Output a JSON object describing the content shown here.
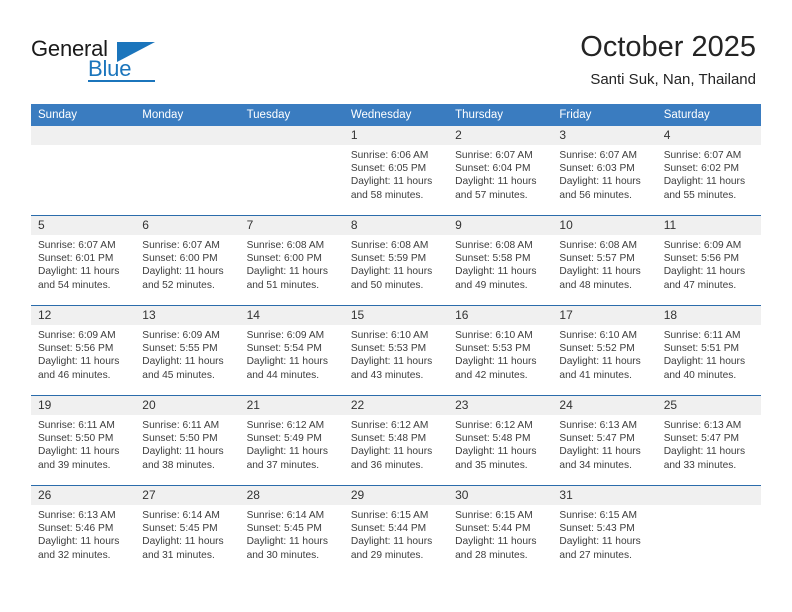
{
  "brand": {
    "name_part1": "General",
    "name_part2": "Blue",
    "accent_color": "#1b75bc"
  },
  "header": {
    "month_title": "October 2025",
    "location": "Santi Suk, Nan, Thailand"
  },
  "calendar": {
    "header_bg": "#3a7cc0",
    "row_divider_color": "#2b6cab",
    "daynum_band_color": "#f0f0f0",
    "weekday_headers": [
      "Sunday",
      "Monday",
      "Tuesday",
      "Wednesday",
      "Thursday",
      "Friday",
      "Saturday"
    ],
    "weeks": [
      [
        {
          "day": "",
          "empty": true,
          "sunrise": "",
          "sunset": "",
          "daylight1": "",
          "daylight2": ""
        },
        {
          "day": "",
          "empty": true,
          "sunrise": "",
          "sunset": "",
          "daylight1": "",
          "daylight2": ""
        },
        {
          "day": "",
          "empty": true,
          "sunrise": "",
          "sunset": "",
          "daylight1": "",
          "daylight2": ""
        },
        {
          "day": "1",
          "empty": false,
          "sunrise": "Sunrise: 6:06 AM",
          "sunset": "Sunset: 6:05 PM",
          "daylight1": "Daylight: 11 hours",
          "daylight2": "and 58 minutes."
        },
        {
          "day": "2",
          "empty": false,
          "sunrise": "Sunrise: 6:07 AM",
          "sunset": "Sunset: 6:04 PM",
          "daylight1": "Daylight: 11 hours",
          "daylight2": "and 57 minutes."
        },
        {
          "day": "3",
          "empty": false,
          "sunrise": "Sunrise: 6:07 AM",
          "sunset": "Sunset: 6:03 PM",
          "daylight1": "Daylight: 11 hours",
          "daylight2": "and 56 minutes."
        },
        {
          "day": "4",
          "empty": false,
          "sunrise": "Sunrise: 6:07 AM",
          "sunset": "Sunset: 6:02 PM",
          "daylight1": "Daylight: 11 hours",
          "daylight2": "and 55 minutes."
        }
      ],
      [
        {
          "day": "5",
          "empty": false,
          "sunrise": "Sunrise: 6:07 AM",
          "sunset": "Sunset: 6:01 PM",
          "daylight1": "Daylight: 11 hours",
          "daylight2": "and 54 minutes."
        },
        {
          "day": "6",
          "empty": false,
          "sunrise": "Sunrise: 6:07 AM",
          "sunset": "Sunset: 6:00 PM",
          "daylight1": "Daylight: 11 hours",
          "daylight2": "and 52 minutes."
        },
        {
          "day": "7",
          "empty": false,
          "sunrise": "Sunrise: 6:08 AM",
          "sunset": "Sunset: 6:00 PM",
          "daylight1": "Daylight: 11 hours",
          "daylight2": "and 51 minutes."
        },
        {
          "day": "8",
          "empty": false,
          "sunrise": "Sunrise: 6:08 AM",
          "sunset": "Sunset: 5:59 PM",
          "daylight1": "Daylight: 11 hours",
          "daylight2": "and 50 minutes."
        },
        {
          "day": "9",
          "empty": false,
          "sunrise": "Sunrise: 6:08 AM",
          "sunset": "Sunset: 5:58 PM",
          "daylight1": "Daylight: 11 hours",
          "daylight2": "and 49 minutes."
        },
        {
          "day": "10",
          "empty": false,
          "sunrise": "Sunrise: 6:08 AM",
          "sunset": "Sunset: 5:57 PM",
          "daylight1": "Daylight: 11 hours",
          "daylight2": "and 48 minutes."
        },
        {
          "day": "11",
          "empty": false,
          "sunrise": "Sunrise: 6:09 AM",
          "sunset": "Sunset: 5:56 PM",
          "daylight1": "Daylight: 11 hours",
          "daylight2": "and 47 minutes."
        }
      ],
      [
        {
          "day": "12",
          "empty": false,
          "sunrise": "Sunrise: 6:09 AM",
          "sunset": "Sunset: 5:56 PM",
          "daylight1": "Daylight: 11 hours",
          "daylight2": "and 46 minutes."
        },
        {
          "day": "13",
          "empty": false,
          "sunrise": "Sunrise: 6:09 AM",
          "sunset": "Sunset: 5:55 PM",
          "daylight1": "Daylight: 11 hours",
          "daylight2": "and 45 minutes."
        },
        {
          "day": "14",
          "empty": false,
          "sunrise": "Sunrise: 6:09 AM",
          "sunset": "Sunset: 5:54 PM",
          "daylight1": "Daylight: 11 hours",
          "daylight2": "and 44 minutes."
        },
        {
          "day": "15",
          "empty": false,
          "sunrise": "Sunrise: 6:10 AM",
          "sunset": "Sunset: 5:53 PM",
          "daylight1": "Daylight: 11 hours",
          "daylight2": "and 43 minutes."
        },
        {
          "day": "16",
          "empty": false,
          "sunrise": "Sunrise: 6:10 AM",
          "sunset": "Sunset: 5:53 PM",
          "daylight1": "Daylight: 11 hours",
          "daylight2": "and 42 minutes."
        },
        {
          "day": "17",
          "empty": false,
          "sunrise": "Sunrise: 6:10 AM",
          "sunset": "Sunset: 5:52 PM",
          "daylight1": "Daylight: 11 hours",
          "daylight2": "and 41 minutes."
        },
        {
          "day": "18",
          "empty": false,
          "sunrise": "Sunrise: 6:11 AM",
          "sunset": "Sunset: 5:51 PM",
          "daylight1": "Daylight: 11 hours",
          "daylight2": "and 40 minutes."
        }
      ],
      [
        {
          "day": "19",
          "empty": false,
          "sunrise": "Sunrise: 6:11 AM",
          "sunset": "Sunset: 5:50 PM",
          "daylight1": "Daylight: 11 hours",
          "daylight2": "and 39 minutes."
        },
        {
          "day": "20",
          "empty": false,
          "sunrise": "Sunrise: 6:11 AM",
          "sunset": "Sunset: 5:50 PM",
          "daylight1": "Daylight: 11 hours",
          "daylight2": "and 38 minutes."
        },
        {
          "day": "21",
          "empty": false,
          "sunrise": "Sunrise: 6:12 AM",
          "sunset": "Sunset: 5:49 PM",
          "daylight1": "Daylight: 11 hours",
          "daylight2": "and 37 minutes."
        },
        {
          "day": "22",
          "empty": false,
          "sunrise": "Sunrise: 6:12 AM",
          "sunset": "Sunset: 5:48 PM",
          "daylight1": "Daylight: 11 hours",
          "daylight2": "and 36 minutes."
        },
        {
          "day": "23",
          "empty": false,
          "sunrise": "Sunrise: 6:12 AM",
          "sunset": "Sunset: 5:48 PM",
          "daylight1": "Daylight: 11 hours",
          "daylight2": "and 35 minutes."
        },
        {
          "day": "24",
          "empty": false,
          "sunrise": "Sunrise: 6:13 AM",
          "sunset": "Sunset: 5:47 PM",
          "daylight1": "Daylight: 11 hours",
          "daylight2": "and 34 minutes."
        },
        {
          "day": "25",
          "empty": false,
          "sunrise": "Sunrise: 6:13 AM",
          "sunset": "Sunset: 5:47 PM",
          "daylight1": "Daylight: 11 hours",
          "daylight2": "and 33 minutes."
        }
      ],
      [
        {
          "day": "26",
          "empty": false,
          "sunrise": "Sunrise: 6:13 AM",
          "sunset": "Sunset: 5:46 PM",
          "daylight1": "Daylight: 11 hours",
          "daylight2": "and 32 minutes."
        },
        {
          "day": "27",
          "empty": false,
          "sunrise": "Sunrise: 6:14 AM",
          "sunset": "Sunset: 5:45 PM",
          "daylight1": "Daylight: 11 hours",
          "daylight2": "and 31 minutes."
        },
        {
          "day": "28",
          "empty": false,
          "sunrise": "Sunrise: 6:14 AM",
          "sunset": "Sunset: 5:45 PM",
          "daylight1": "Daylight: 11 hours",
          "daylight2": "and 30 minutes."
        },
        {
          "day": "29",
          "empty": false,
          "sunrise": "Sunrise: 6:15 AM",
          "sunset": "Sunset: 5:44 PM",
          "daylight1": "Daylight: 11 hours",
          "daylight2": "and 29 minutes."
        },
        {
          "day": "30",
          "empty": false,
          "sunrise": "Sunrise: 6:15 AM",
          "sunset": "Sunset: 5:44 PM",
          "daylight1": "Daylight: 11 hours",
          "daylight2": "and 28 minutes."
        },
        {
          "day": "31",
          "empty": false,
          "sunrise": "Sunrise: 6:15 AM",
          "sunset": "Sunset: 5:43 PM",
          "daylight1": "Daylight: 11 hours",
          "daylight2": "and 27 minutes."
        },
        {
          "day": "",
          "empty": true,
          "sunrise": "",
          "sunset": "",
          "daylight1": "",
          "daylight2": ""
        }
      ]
    ]
  }
}
